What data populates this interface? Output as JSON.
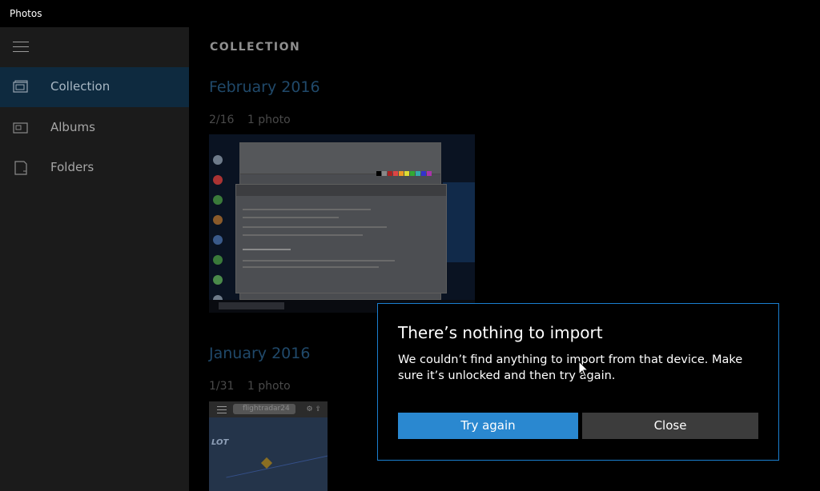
{
  "window": {
    "title": "Photos"
  },
  "sidebar": {
    "items": [
      {
        "label": "Collection",
        "icon": "collection-icon",
        "active": true
      },
      {
        "label": "Albums",
        "icon": "albums-icon",
        "active": false
      },
      {
        "label": "Folders",
        "icon": "folders-icon",
        "active": false
      }
    ]
  },
  "header": {
    "title": "COLLECTION"
  },
  "groups": [
    {
      "month": "February 2016",
      "date": "2/16",
      "count": "1 photo"
    },
    {
      "month": "January 2016",
      "date": "1/31",
      "count": "1 photo"
    }
  ],
  "thumbnails": {
    "second_search_text": "flightradar24",
    "second_logo_text": "LOT"
  },
  "dialog": {
    "title": "There’s nothing to import",
    "message": "We couldn’t find anything to import from that device. Make sure it’s unlocked and then try again.",
    "primary_label": "Try again",
    "secondary_label": "Close"
  },
  "colors": {
    "accent": "#2a88d0",
    "dialog_border": "#1a7fd0",
    "sidebar_active": "#0e2a3f"
  }
}
